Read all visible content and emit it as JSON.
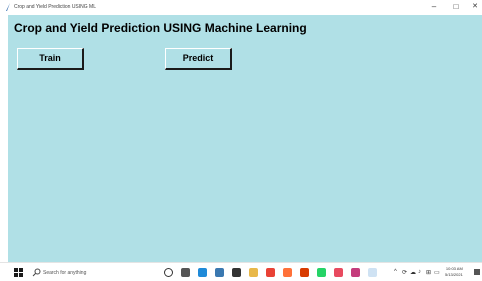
{
  "window": {
    "title": "Crop and Yield Prediction USING ML",
    "minimize_glyph": "–",
    "maximize_glyph": "□",
    "close_glyph": "✕",
    "background": "#b0e0e6"
  },
  "main": {
    "heading": "Crop and Yield Prediction USING Machine Learning",
    "buttons": [
      {
        "label": "Train"
      },
      {
        "label": "Predict"
      }
    ]
  },
  "taskbar": {
    "search_placeholder": "Search for anything",
    "pinned_icons": [
      {
        "name": "cortana-icon",
        "color": "#333333"
      },
      {
        "name": "task-view-icon",
        "color": "#555555"
      },
      {
        "name": "edge-icon",
        "color": "#1f8ad8"
      },
      {
        "name": "python-icon",
        "color": "#3a78b0"
      },
      {
        "name": "store-icon",
        "color": "#333333"
      },
      {
        "name": "file-explorer-icon",
        "color": "#e8b84a"
      },
      {
        "name": "chrome-icon",
        "color": "#e94235"
      },
      {
        "name": "firefox-icon",
        "color": "#ff7139"
      },
      {
        "name": "office-icon",
        "color": "#d83b01"
      },
      {
        "name": "whatsapp-icon",
        "color": "#25d366"
      },
      {
        "name": "media-icon",
        "color": "#e84a5f"
      },
      {
        "name": "app-icon",
        "color": "#c43c7c"
      },
      {
        "name": "document-icon",
        "color": "#cfe2f3"
      }
    ],
    "tray_icons": [
      "^",
      "⟳",
      "☁",
      "♪",
      "⊞",
      "▭"
    ],
    "clock_time": "10:03 AM",
    "clock_date": "5/13/2021"
  }
}
